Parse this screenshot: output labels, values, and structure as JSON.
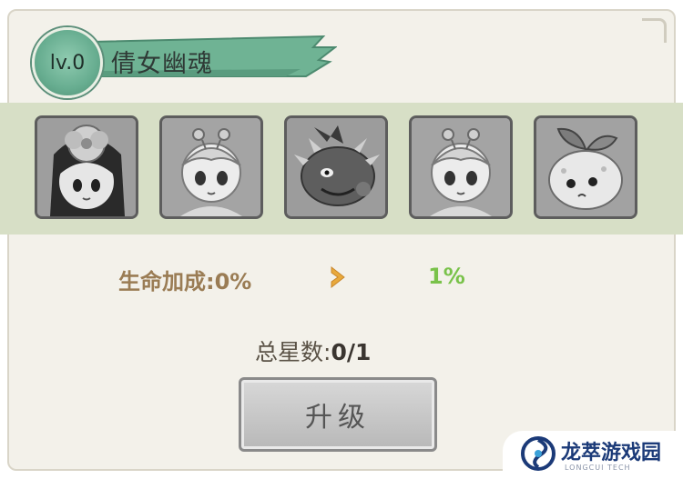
{
  "header": {
    "level": "lv.0",
    "title": "倩女幽魂"
  },
  "portraits": [
    {
      "icon": "girl-flower-hat-portrait"
    },
    {
      "icon": "boy-sprout-hair-portrait"
    },
    {
      "icon": "horned-monster-portrait"
    },
    {
      "icon": "boy-sprout-hair-portrait"
    },
    {
      "icon": "leaf-blob-creature-portrait"
    }
  ],
  "stats": {
    "hp_bonus_label": "生命加成:0%",
    "hp_bonus_next": "1%",
    "stars_label": "总星数:",
    "stars_value": "0/1"
  },
  "upgrade_button": {
    "label": "升级",
    "state": "disabled"
  },
  "watermark": {
    "title": "龙萃游戏园",
    "subtitle": "LONGCUI TECH"
  },
  "colors": {
    "panel": "#f3f1ea",
    "strip": "#d7dfc6",
    "ribbon": "#6fb394",
    "stat_label": "#9a7c54",
    "stat_next": "#79c24a",
    "arrow": "#e8a93c"
  }
}
